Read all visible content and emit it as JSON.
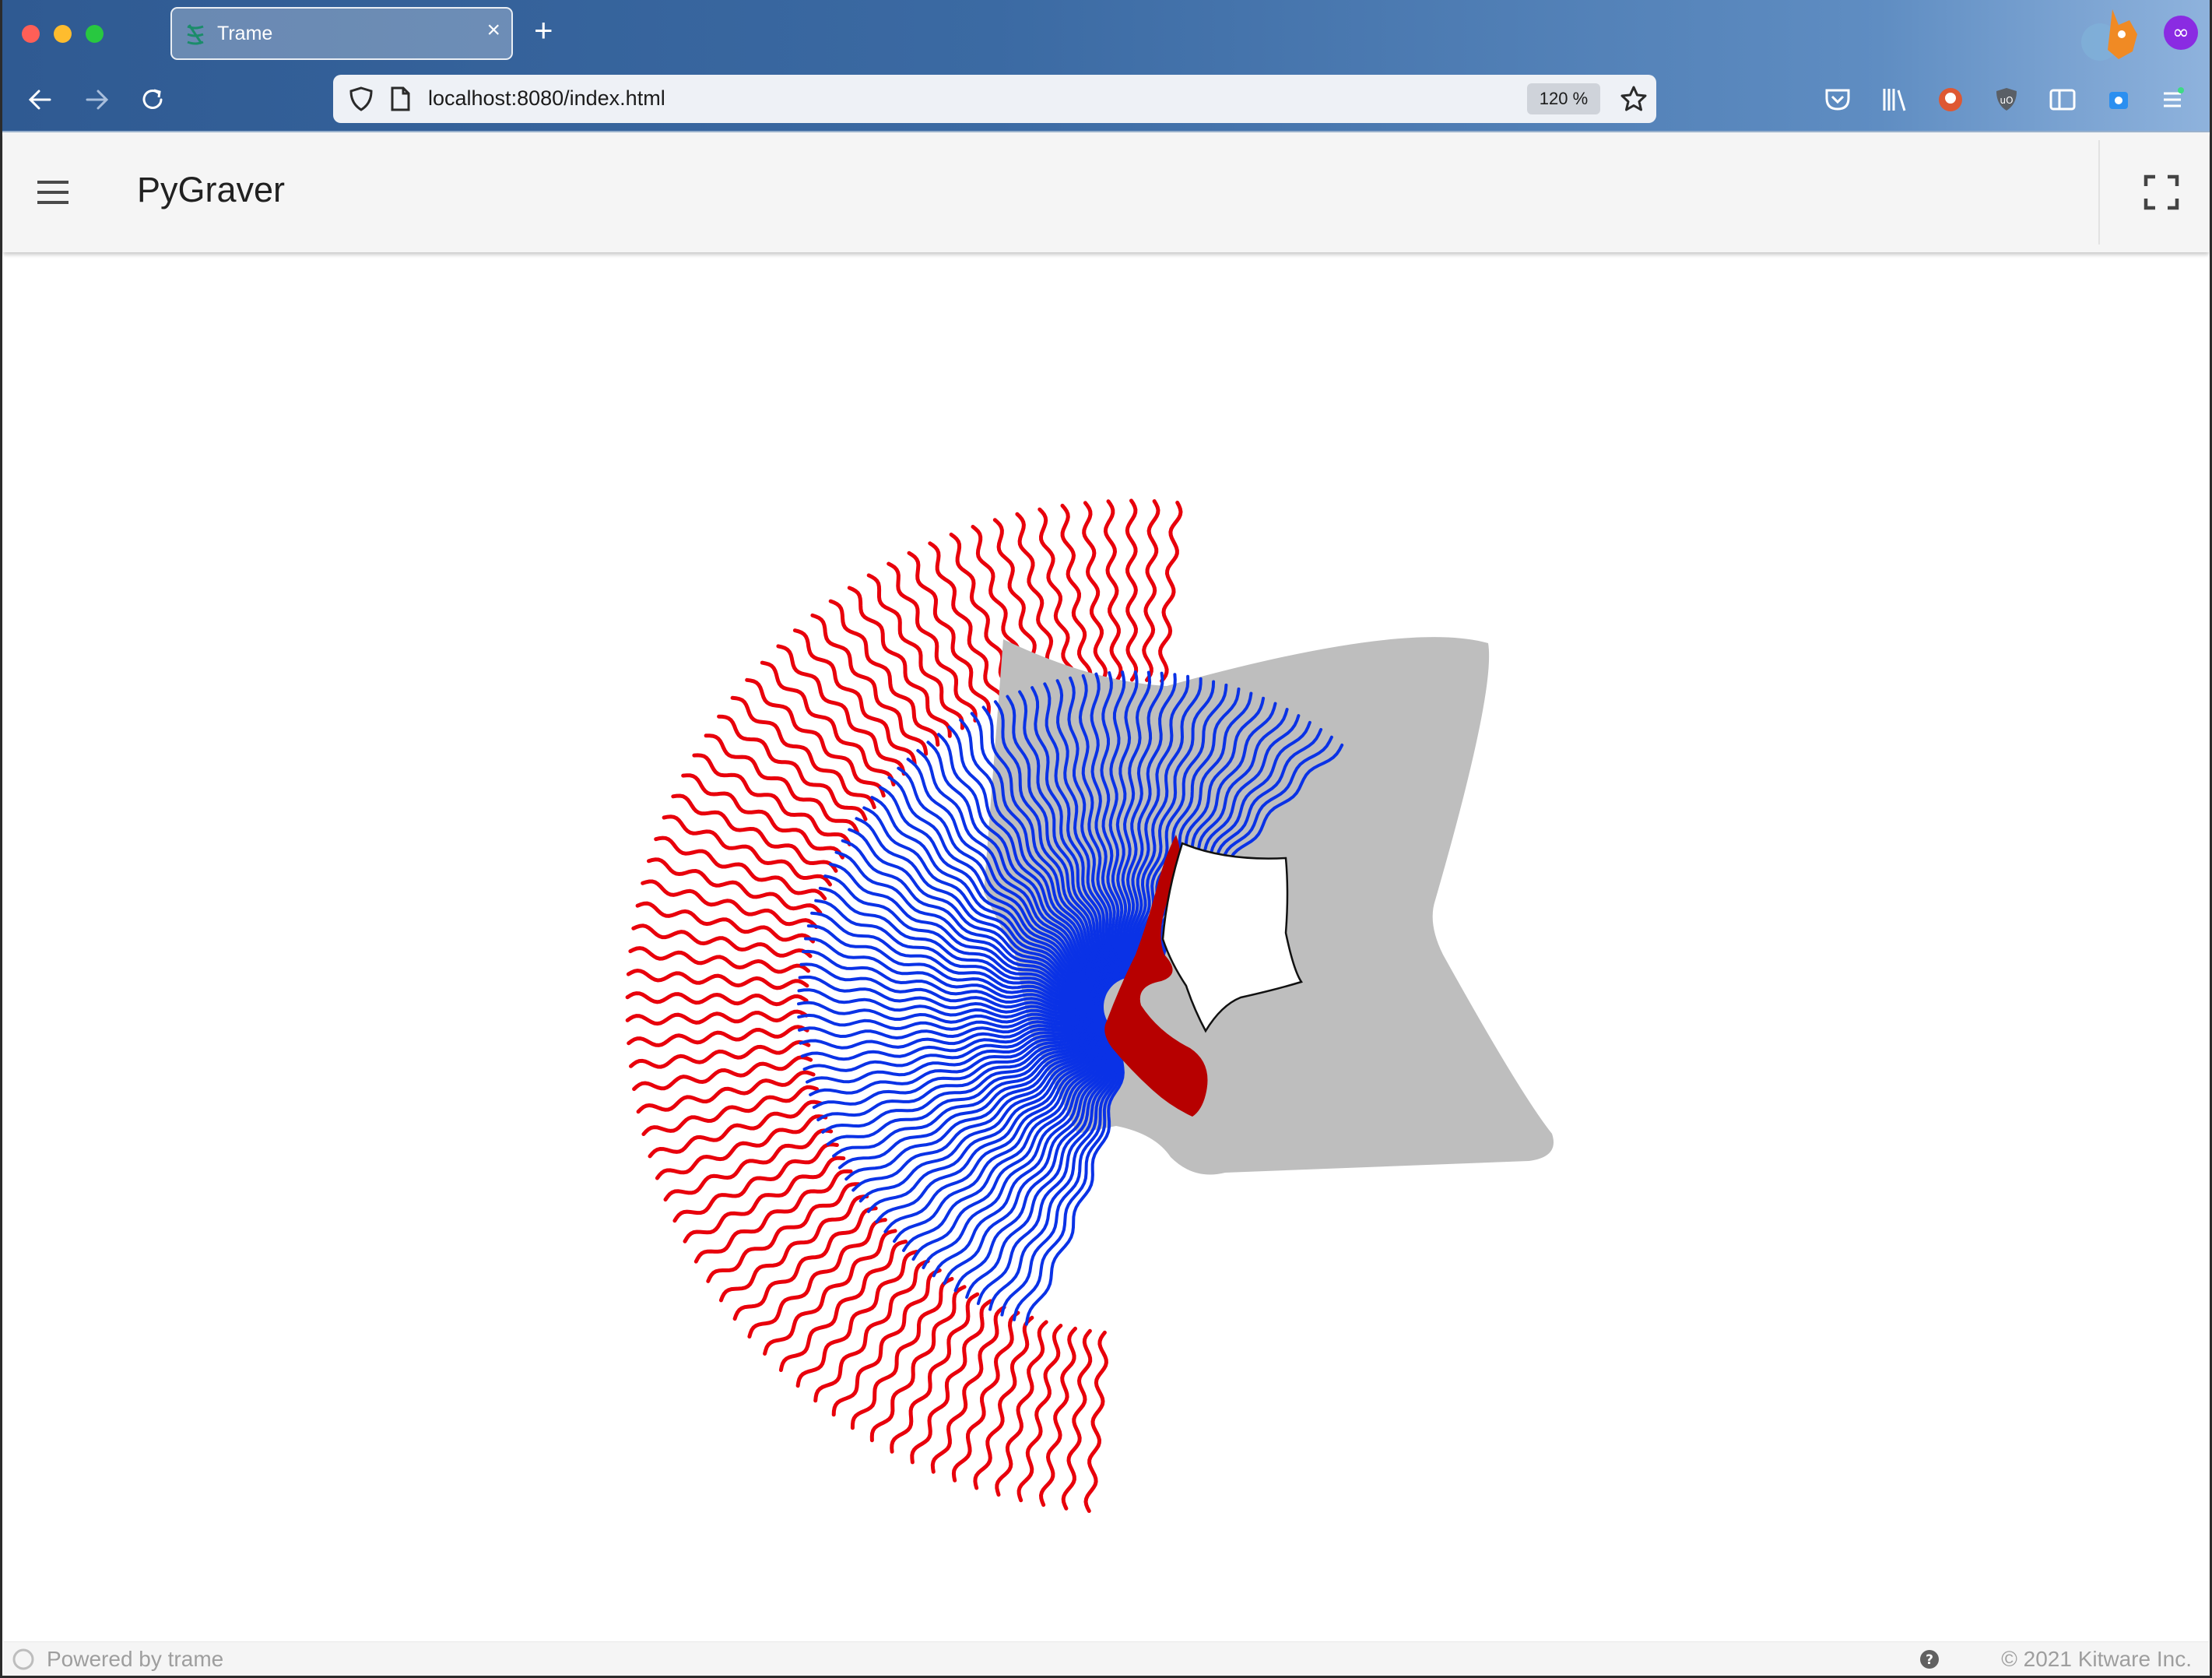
{
  "browser": {
    "tab_title": "Trame",
    "tab_close_glyph": "×",
    "new_tab_glyph": "+",
    "url": "localhost:8080/index.html",
    "zoom": "120 %",
    "icons": [
      "back-icon",
      "forward-icon",
      "reload-icon",
      "shield-icon",
      "page-icon",
      "bookmark-star-icon",
      "pocket-icon",
      "library-icon",
      "duckduckgo-icon",
      "ublock-icon",
      "sidebar-icon",
      "container-icon",
      "extension-icon",
      "overflow-menu-icon"
    ]
  },
  "app": {
    "title": "PyGraver",
    "menu_icon": "hamburger-menu-icon",
    "fullscreen_icon": "fullscreen-icon"
  },
  "colors": {
    "red": "#e8000b",
    "dark_red": "#b70000",
    "blue": "#0a32e6",
    "gray": "#bebebe"
  },
  "footer": {
    "powered_by": "Powered by trame",
    "help_icon": "help-circle-icon",
    "copyright": "© 2021 Kitware Inc."
  }
}
